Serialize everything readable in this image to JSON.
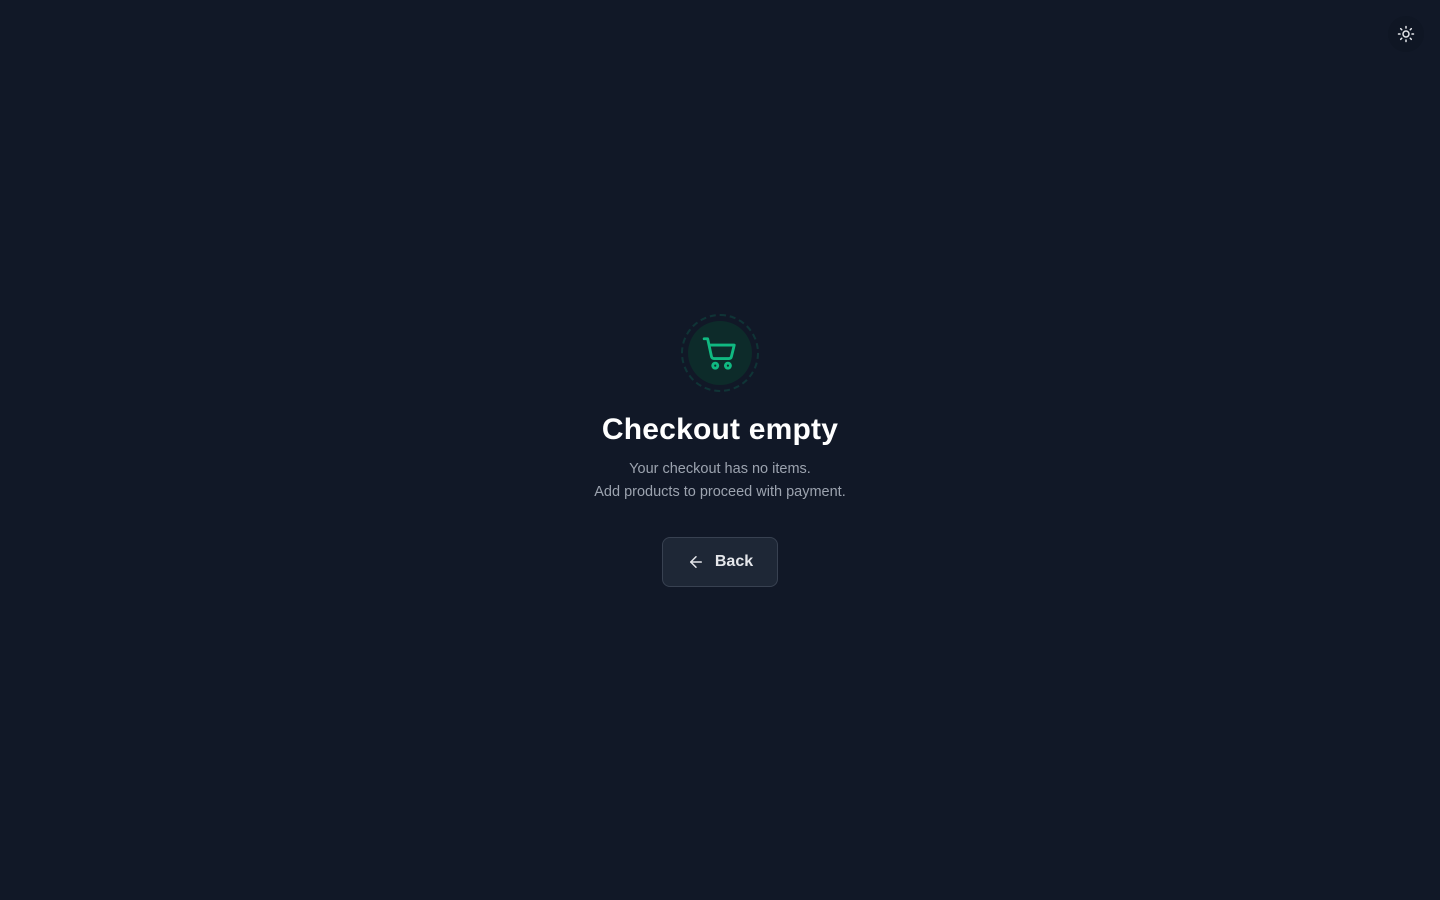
{
  "theme_toggle": {
    "icon": "sun-icon",
    "color": "#e5e7eb"
  },
  "empty_state": {
    "icon": "shopping-cart-icon",
    "accent_color": "#10b981",
    "title": "Checkout empty",
    "description_line1": "Your checkout has no items.",
    "description_line2": "Add products to proceed with payment."
  },
  "back_button": {
    "icon": "arrow-left-icon",
    "label": "Back"
  },
  "colors": {
    "background": "#111827",
    "button_bg": "#1e2736",
    "muted_text": "#9ca3af"
  }
}
